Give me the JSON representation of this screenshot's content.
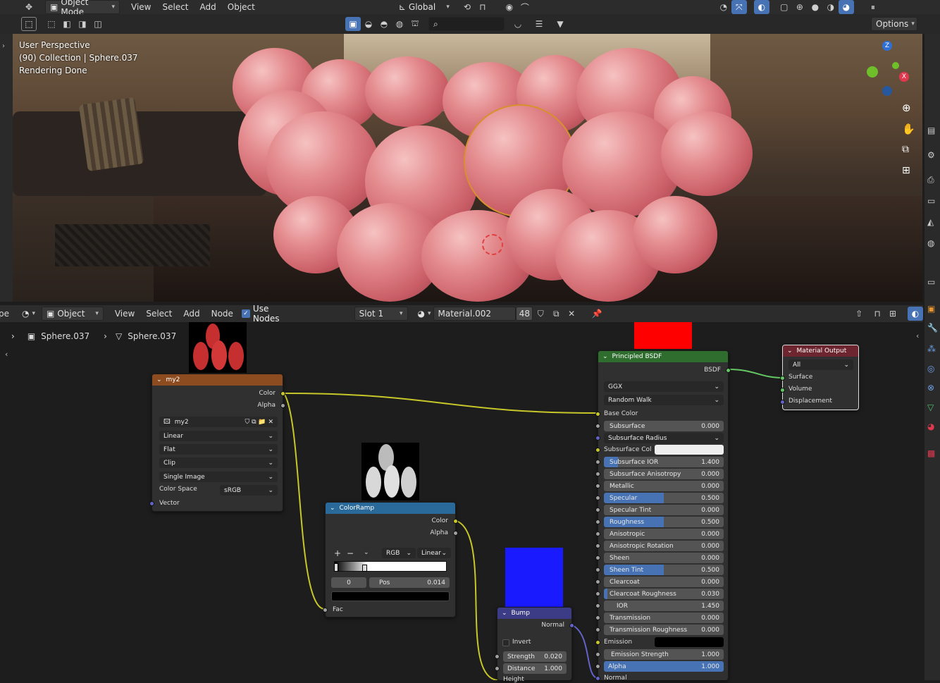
{
  "top_header": {
    "mode": "Object Mode",
    "menus": [
      "View",
      "Select",
      "Add",
      "Object"
    ],
    "transform_orientation": "Global",
    "options_label": "Options"
  },
  "viewport": {
    "perspective": "User Perspective",
    "collection": "(90) Collection | Sphere.037",
    "status": "Rendering Done",
    "gizmo_axes": [
      "Z",
      "Y",
      "X"
    ]
  },
  "node_header": {
    "editor_label": "pe",
    "object_dropdown": "Object",
    "menus": [
      "View",
      "Select",
      "Add",
      "Node"
    ],
    "use_nodes_label": "Use Nodes",
    "slot": "Slot 1",
    "material": "Material.002",
    "users": "48"
  },
  "breadcrumb": {
    "object": "Sphere.037",
    "mesh": "Sphere.037"
  },
  "image_node": {
    "title": "my2",
    "out_color": "Color",
    "out_alpha": "Alpha",
    "image_name": "my2",
    "interpolation": "Linear",
    "projection": "Flat",
    "extension": "Clip",
    "source": "Single Image",
    "color_space_label": "Color Space",
    "color_space": "sRGB",
    "in_vector": "Vector"
  },
  "colorramp_node": {
    "title": "ColorRamp",
    "out_color": "Color",
    "out_alpha": "Alpha",
    "add": "+",
    "remove": "−",
    "mode": "RGB",
    "interp": "Linear",
    "index": "0",
    "pos_label": "Pos",
    "pos_value": "0.014",
    "in_fac": "Fac"
  },
  "bump_node": {
    "title": "Bump",
    "out_normal": "Normal",
    "invert": "Invert",
    "strength_label": "Strength",
    "strength": "0.020",
    "distance_label": "Distance",
    "distance": "1.000",
    "height": "Height",
    "normal_in": "Normal"
  },
  "bsdf_node": {
    "title": "Principled BSDF",
    "out_bsdf": "BSDF",
    "distribution": "GGX",
    "subsurface_method": "Random Walk",
    "base_color": "Base Color",
    "subsurface_radius": "Subsurface Radius",
    "subsurface_color": "Subsurface Col",
    "emission": "Emission",
    "normal": "Normal",
    "params": [
      {
        "label": "Subsurface",
        "value": "0.000",
        "fill": 0
      },
      {
        "label": "Subsurface IOR",
        "value": "1.400",
        "fill": 0.12
      },
      {
        "label": "Subsurface Anisotropy",
        "value": "0.000",
        "fill": 0
      },
      {
        "label": "Metallic",
        "value": "0.000",
        "fill": 0
      },
      {
        "label": "Specular",
        "value": "0.500",
        "fill": 0.5
      },
      {
        "label": "Specular Tint",
        "value": "0.000",
        "fill": 0
      },
      {
        "label": "Roughness",
        "value": "0.500",
        "fill": 0.5
      },
      {
        "label": "Anisotropic",
        "value": "0.000",
        "fill": 0
      },
      {
        "label": "Anisotropic Rotation",
        "value": "0.000",
        "fill": 0
      },
      {
        "label": "Sheen",
        "value": "0.000",
        "fill": 0
      },
      {
        "label": "Sheen Tint",
        "value": "0.500",
        "fill": 0.5
      },
      {
        "label": "Clearcoat",
        "value": "0.000",
        "fill": 0
      },
      {
        "label": "Clearcoat Roughness",
        "value": "0.030",
        "fill": 0.03
      },
      {
        "label": "IOR",
        "value": "1.450",
        "fill": 0
      },
      {
        "label": "Transmission",
        "value": "0.000",
        "fill": 0
      },
      {
        "label": "Transmission Roughness",
        "value": "0.000",
        "fill": 0
      }
    ],
    "emission_strength_label": "Emission Strength",
    "emission_strength": "1.000",
    "alpha_label": "Alpha",
    "alpha": "1.000",
    "alpha_fill": 1.0
  },
  "output_node": {
    "title": "Material Output",
    "target": "All",
    "surface": "Surface",
    "volume": "Volume",
    "displacement": "Displacement"
  },
  "colors": {
    "accent": "#4772b3",
    "image_header": "#8d4c20",
    "colorramp_header": "#2a6a9a",
    "bump_header": "#3b3b86",
    "bsdf_header": "#2f6d2f",
    "output_header": "#6d2630",
    "base_color_preview": "#ff0000",
    "normal_preview": "#1a1aff"
  }
}
